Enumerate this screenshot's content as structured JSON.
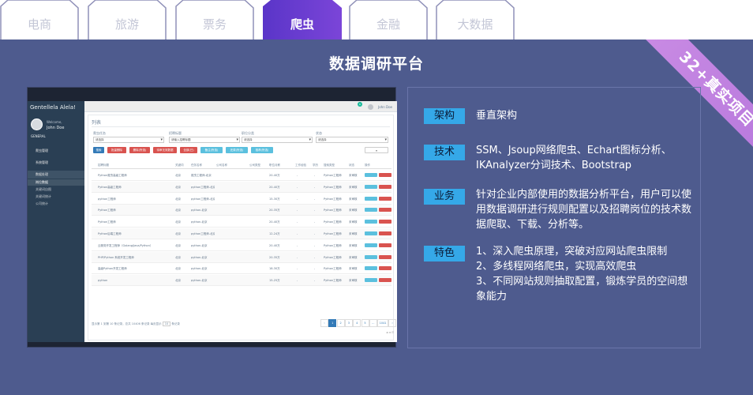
{
  "tabs": [
    {
      "label": "电商",
      "active": false
    },
    {
      "label": "旅游",
      "active": false
    },
    {
      "label": "票务",
      "active": false
    },
    {
      "label": "爬虫",
      "active": true
    },
    {
      "label": "金融",
      "active": false
    },
    {
      "label": "大数据",
      "active": false
    }
  ],
  "page_title": "数据调研平台",
  "ribbon": "32+真实项目",
  "screenshot": {
    "brand": "Gentellela Alela!",
    "welcome": "Welcome,",
    "user": "John Doe",
    "section": "GENERAL",
    "menu": [
      "爬虫管理",
      "系统管理",
      "数据处理"
    ],
    "submenu": [
      "岗位数据",
      "关键词自图",
      "关键词统计",
      "公司统计"
    ],
    "topbar_user": "John Doe",
    "topbar_badge": "6",
    "panel_title": "列表",
    "filters": [
      {
        "label": "爬虫任务",
        "value": "请选择"
      },
      {
        "label": "招聘标题",
        "value": "请输入招聘标题"
      },
      {
        "label": "职位分类",
        "value": "请选择"
      },
      {
        "label": "状态",
        "value": "请选择"
      }
    ],
    "buttons": [
      {
        "label": "搜索",
        "color": "#337ab7"
      },
      {
        "label": "批量删除",
        "color": "#d9534f"
      },
      {
        "label": "删除(所选)",
        "color": "#d9534f"
      },
      {
        "label": "待审无效数据",
        "color": "#d9534f"
      },
      {
        "label": "全部(已)",
        "color": "#d9534f"
      },
      {
        "label": "备注(所选)",
        "color": "#5bc0de"
      },
      {
        "label": "还原(所选)",
        "color": "#5bc0de"
      },
      {
        "label": "推荐(所选)",
        "color": "#5bc0de"
      }
    ],
    "columns": [
      "招聘标题",
      "关键词",
      "任务名称",
      "公司名称",
      "公司类型",
      "职位月薪",
      "工作经验",
      "学历",
      "搜索类型",
      "状态",
      "操作"
    ],
    "rows": [
      {
        "title": "Python爬虫高级工程师",
        "kw": "北京",
        "task": "爬虫工程师-北京",
        "salary": "20-40万",
        "type": "Python工程师",
        "status": "未审核"
      },
      {
        "title": "Python高级工程师",
        "kw": "北京",
        "task": "python工程师-北京",
        "salary": "20-40万",
        "type": "Python工程师",
        "status": "未审核"
      },
      {
        "title": "python工程师",
        "kw": "北京",
        "task": "python工程师-北京",
        "salary": "15-30万",
        "type": "Python工程师",
        "status": "未审核"
      },
      {
        "title": "Python工程师",
        "kw": "北京",
        "task": "python-北京",
        "salary": "20-35万",
        "type": "Python工程师",
        "status": "未审核"
      },
      {
        "title": "Python工程师",
        "kw": "北京",
        "task": "python-北京",
        "salary": "20-40万",
        "type": "Python工程师",
        "status": "未审核"
      },
      {
        "title": "Python后端工程师",
        "kw": "北京",
        "task": "python工程师-北京",
        "salary": "12-24万",
        "type": "Python工程师",
        "status": "未审核"
      },
      {
        "title": "云服务开发工程师（Golang/Java/Python）",
        "kw": "北京",
        "task": "python-北京",
        "salary": "20-40万",
        "type": "Python工程师",
        "status": "未审核"
      },
      {
        "title": "PHP/Python 系统开发工程师",
        "kw": "北京",
        "task": "python-北京",
        "salary": "20-35万",
        "type": "Python工程师",
        "status": "未审核"
      },
      {
        "title": "高级Python开发工程师",
        "kw": "北京",
        "task": "python-北京",
        "salary": "18-30万",
        "type": "Python工程师",
        "status": "未审核"
      },
      {
        "title": "python",
        "kw": "北京",
        "task": "python-北京",
        "salary": "15-25万",
        "type": "Python工程师",
        "status": "未审核"
      }
    ],
    "footer": "显示第 1 到第 10 条记录，总共 10406 条记录 每页显示",
    "page_size": "10",
    "footer_suffix": "条记录",
    "pages": [
      "‹",
      "1",
      "2",
      "3",
      "4",
      "5",
      "...",
      "1041",
      "›"
    ]
  },
  "info": [
    {
      "label": "架构",
      "text": "垂直架构"
    },
    {
      "label": "技术",
      "text": "SSM、Jsoup网络爬虫、Echart图标分析、IKAnalyzer分词技术、Bootstrap"
    },
    {
      "label": "业务",
      "text": "针对企业内部使用的数据分析平台，用户可以使用数据调研进行规则配置以及招聘岗位的技术数据爬取、下载、分析等。"
    },
    {
      "label": "特色",
      "lines": [
        "1、深入爬虫原理，突破对应网站爬虫限制",
        "2、多线程网络爬虫，实现高效爬虫",
        "3、不同网站规则抽取配置，锻炼学员的空间想象能力"
      ]
    }
  ],
  "colors": {
    "bg": "#4e5b8e",
    "tab_active": "#6a3bd1",
    "ribbon": "#c98be4",
    "badge": "#35a8e8"
  }
}
